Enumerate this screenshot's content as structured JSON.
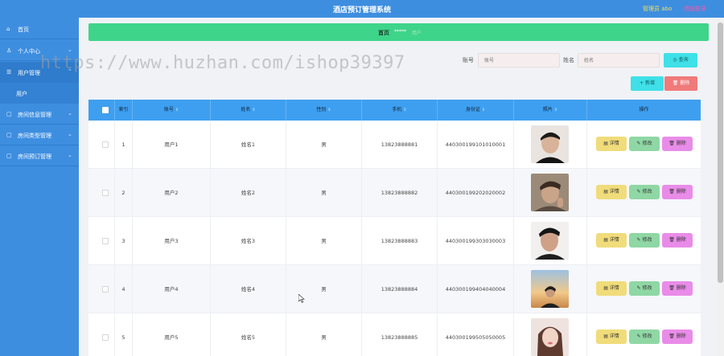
{
  "header": {
    "title": "酒店预订管理系统",
    "admin": "管理员 abo",
    "logout": "退出登录"
  },
  "watermark": "https://www.huzhan.com/ishop39397",
  "sidebar": {
    "items": [
      {
        "label": "首页",
        "icon": "home-icon",
        "glyph": "⌂"
      },
      {
        "label": "个人中心",
        "icon": "user-icon",
        "glyph": "♙"
      },
      {
        "label": "用户管理",
        "icon": "users-icon",
        "glyph": "☰"
      },
      {
        "label": "房间信息管理",
        "icon": "room-icon",
        "glyph": "▢"
      },
      {
        "label": "房间类型管理",
        "icon": "category-icon",
        "glyph": "▢"
      },
      {
        "label": "房间预订管理",
        "icon": "booking-icon",
        "glyph": "▢"
      }
    ],
    "submenu": {
      "label": "用户"
    }
  },
  "breadcrumb": {
    "home": "首页",
    "sep": "*****",
    "current": "用户"
  },
  "search": {
    "account_label": "账号",
    "account_placeholder": "账号",
    "name_label": "姓名",
    "name_placeholder": "姓名",
    "search_button": "◎ 查询"
  },
  "toolbar": {
    "add_label": "+ 新增",
    "delete_label": "🗑 删除"
  },
  "table": {
    "columns": [
      "索引",
      "账号",
      "姓名",
      "性别",
      "手机",
      "身份证",
      "照片",
      "操作"
    ],
    "sort_glyph": "⇕",
    "action_labels": {
      "detail": "▤ 详情",
      "edit": "✎ 修改",
      "delete": "🗑 删除"
    },
    "rows": [
      {
        "index": "1",
        "account": "用户1",
        "name": "姓名1",
        "gender": "男",
        "phone": "13823888881",
        "id": "440300199101010001"
      },
      {
        "index": "2",
        "account": "用户2",
        "name": "姓名2",
        "gender": "男",
        "phone": "13823888882",
        "id": "440300199202020002"
      },
      {
        "index": "3",
        "account": "用户3",
        "name": "姓名3",
        "gender": "男",
        "phone": "13823888883",
        "id": "440300199303030003"
      },
      {
        "index": "4",
        "account": "用户4",
        "name": "姓名4",
        "gender": "男",
        "phone": "13823888884",
        "id": "440300199404040004"
      },
      {
        "index": "5",
        "account": "用户5",
        "name": "姓名5",
        "gender": "男",
        "phone": "13823888885",
        "id": "440300199505050005"
      }
    ]
  },
  "colors": {
    "primary": "#3e8ee0",
    "breadcrumb": "#3ed48a",
    "table_header": "#3e9ff0",
    "admin_text": "#f2e05a",
    "logout_text": "#ff55aa"
  }
}
